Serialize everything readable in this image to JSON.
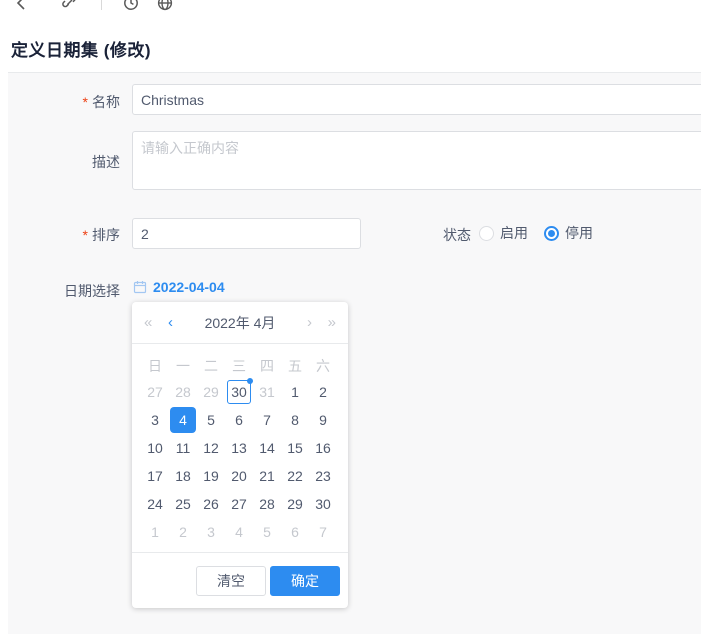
{
  "page": {
    "title": "定义日期集 (修改)"
  },
  "toolbar": {
    "icons": [
      "back-icon",
      "link-icon",
      "history-icon",
      "globe-icon"
    ]
  },
  "form": {
    "required_mark": "*",
    "name": {
      "label": "名称",
      "required": true,
      "value": "Christmas"
    },
    "description": {
      "label": "描述",
      "placeholder": "请输入正确内容",
      "value": ""
    },
    "sort": {
      "label": "排序",
      "required": true,
      "value": "2"
    },
    "status": {
      "label": "状态",
      "options": [
        {
          "label": "启用",
          "selected": false
        },
        {
          "label": "停用",
          "selected": true
        }
      ]
    },
    "date": {
      "label": "日期选择",
      "value": "2022-04-04"
    }
  },
  "calendar": {
    "title": "2022年 4月",
    "nav": {
      "prev_year": "«",
      "prev_month": "‹",
      "next_month": "›",
      "next_year": "»"
    },
    "weekdays": [
      "日",
      "一",
      "二",
      "三",
      "四",
      "五",
      "六"
    ],
    "weeks": [
      [
        {
          "d": "27",
          "state": "prev"
        },
        {
          "d": "28",
          "state": "prev"
        },
        {
          "d": "29",
          "state": "prev"
        },
        {
          "d": "30",
          "state": "today"
        },
        {
          "d": "31",
          "state": "prev"
        },
        {
          "d": "1",
          "state": "cur"
        },
        {
          "d": "2",
          "state": "cur"
        }
      ],
      [
        {
          "d": "3",
          "state": "cur"
        },
        {
          "d": "4",
          "state": "selected"
        },
        {
          "d": "5",
          "state": "cur"
        },
        {
          "d": "6",
          "state": "cur"
        },
        {
          "d": "7",
          "state": "cur"
        },
        {
          "d": "8",
          "state": "cur"
        },
        {
          "d": "9",
          "state": "cur"
        }
      ],
      [
        {
          "d": "10",
          "state": "cur"
        },
        {
          "d": "11",
          "state": "cur"
        },
        {
          "d": "12",
          "state": "cur"
        },
        {
          "d": "13",
          "state": "cur"
        },
        {
          "d": "14",
          "state": "cur"
        },
        {
          "d": "15",
          "state": "cur"
        },
        {
          "d": "16",
          "state": "cur"
        }
      ],
      [
        {
          "d": "17",
          "state": "cur"
        },
        {
          "d": "18",
          "state": "cur"
        },
        {
          "d": "19",
          "state": "cur"
        },
        {
          "d": "20",
          "state": "cur"
        },
        {
          "d": "21",
          "state": "cur"
        },
        {
          "d": "22",
          "state": "cur"
        },
        {
          "d": "23",
          "state": "cur"
        }
      ],
      [
        {
          "d": "24",
          "state": "cur"
        },
        {
          "d": "25",
          "state": "cur"
        },
        {
          "d": "26",
          "state": "cur"
        },
        {
          "d": "27",
          "state": "cur"
        },
        {
          "d": "28",
          "state": "cur"
        },
        {
          "d": "29",
          "state": "cur"
        },
        {
          "d": "30",
          "state": "cur"
        }
      ],
      [
        {
          "d": "1",
          "state": "next"
        },
        {
          "d": "2",
          "state": "next"
        },
        {
          "d": "3",
          "state": "next"
        },
        {
          "d": "4",
          "state": "next"
        },
        {
          "d": "5",
          "state": "next"
        },
        {
          "d": "6",
          "state": "next"
        },
        {
          "d": "7",
          "state": "next"
        }
      ]
    ],
    "footer": {
      "clear": "清空",
      "ok": "确定"
    }
  },
  "colors": {
    "primary": "#2d8cf0",
    "required_red": "#ed4014",
    "muted": "#c5c8ce",
    "panel_bg": "#f8f8f9"
  }
}
